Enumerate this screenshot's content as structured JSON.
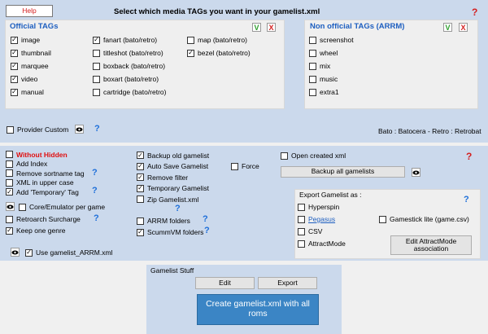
{
  "top": {
    "help_label": "Help",
    "title": "Select which media TAGs you want in your gamelist.xml",
    "question": "?",
    "official": {
      "title": "Official TAGs",
      "col1": [
        {
          "label": "image",
          "checked": true
        },
        {
          "label": "thumbnail",
          "checked": true
        },
        {
          "label": "marquee",
          "checked": true
        },
        {
          "label": "video",
          "checked": true
        },
        {
          "label": "manual",
          "checked": true
        }
      ],
      "col2": [
        {
          "label": "fanart (bato/retro)",
          "checked": true
        },
        {
          "label": "titleshot (bato/retro)",
          "checked": false
        },
        {
          "label": "boxback (bato/retro)",
          "checked": false
        },
        {
          "label": "boxart (bato/retro)",
          "checked": false
        },
        {
          "label": "cartridge (bato/retro)",
          "checked": false
        }
      ],
      "col3": [
        {
          "label": "map (bato/retro)",
          "checked": false
        },
        {
          "label": "bezel (bato/retro)",
          "checked": true
        }
      ],
      "v_label": "V",
      "x_label": "X"
    },
    "nonofficial": {
      "title": "Non official TAGs  (ARRM)",
      "items": [
        {
          "label": "screenshot",
          "checked": false
        },
        {
          "label": "wheel",
          "checked": false
        },
        {
          "label": "mix",
          "checked": false
        },
        {
          "label": "music",
          "checked": false
        },
        {
          "label": "extra1",
          "checked": false
        }
      ],
      "v_label": "V",
      "x_label": "X"
    },
    "provider_custom": "Provider Custom",
    "provider_q": "?",
    "legend": "Bato : Batocera - Retro : Retrobat"
  },
  "mid": {
    "col1": {
      "without_hidden": "Without Hidden",
      "add_index": "Add Index",
      "remove_sortname": "Remove sortname tag",
      "xml_upper": "XML in upper case",
      "add_temporary": "Add 'Temporary' Tag",
      "core_emulator": "Core/Emulator per game",
      "retroarch_surcharge": "Retroarch Surcharge",
      "keep_one_genre": "Keep one genre",
      "use_gamelist_arrm": "Use gamelist_ARRM.xml"
    },
    "col2": {
      "backup_old": "Backup old gamelist",
      "auto_save": "Auto Save Gamelist",
      "remove_filter": "Remove filter",
      "temporary_gamelist": "Temporary Gamelist",
      "zip_gamelist": "Zip Gamelist.xml",
      "arrm_folders": "ARRM folders",
      "scummvm_folders": "ScummVM folders",
      "force": "Force"
    },
    "col3": {
      "open_created": "Open created xml",
      "backup_all": "Backup all gamelists",
      "export_title": "Export Gamelist as :",
      "hyperspin": "Hyperspin",
      "pegasus": "Pegasus",
      "gamestick": "Gamestick lite (game.csv)",
      "csv": "CSV",
      "attractmode": "AttractMode",
      "edit_attract": "Edit AttractMode association"
    },
    "q": "?"
  },
  "bottom": {
    "title": "Gamelist Stuff",
    "edit": "Edit",
    "export": "Export",
    "create": "Create gamelist.xml with all roms"
  }
}
